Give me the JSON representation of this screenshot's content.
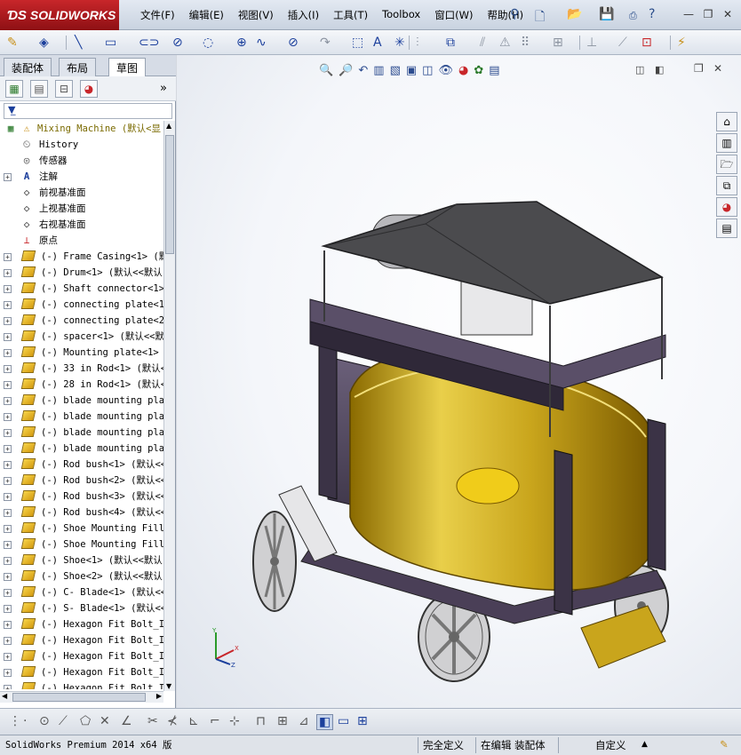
{
  "app": {
    "logo_text": "SOLIDWORKS",
    "menus": [
      "文件(F)",
      "编辑(E)",
      "视图(V)",
      "插入(I)",
      "工具(T)",
      "Toolbox",
      "窗口(W)",
      "帮助(H)"
    ]
  },
  "sidebar": {
    "tabs": [
      "装配体",
      "布局",
      "草图"
    ],
    "active_tab": "草图",
    "tree": [
      {
        "label": "Mixing Machine  (默认<显",
        "kind": "root"
      },
      {
        "label": "History",
        "kind": "history"
      },
      {
        "label": "传感器",
        "kind": "sensor"
      },
      {
        "label": "注解",
        "kind": "annotation"
      },
      {
        "label": "前视基准面",
        "kind": "plane"
      },
      {
        "label": "上视基准面",
        "kind": "plane"
      },
      {
        "label": "右视基准面",
        "kind": "plane"
      },
      {
        "label": "原点",
        "kind": "origin"
      },
      {
        "label": "(-) Frame Casing<1>  (默",
        "kind": "part"
      },
      {
        "label": "(-) Drum<1>  (默认<<默认",
        "kind": "part"
      },
      {
        "label": "(-) Shaft connector<1>",
        "kind": "part"
      },
      {
        "label": "(-) connecting plate<1>",
        "kind": "part"
      },
      {
        "label": "(-) connecting plate<2>",
        "kind": "part"
      },
      {
        "label": "(-) spacer<1>  (默认<<默",
        "kind": "part"
      },
      {
        "label": "(-) Mounting plate<1>  (",
        "kind": "part"
      },
      {
        "label": "(-) 33 in Rod<1>  (默认<",
        "kind": "part"
      },
      {
        "label": "(-) 28 in Rod<1>  (默认<",
        "kind": "part"
      },
      {
        "label": "(-) blade mounting plat",
        "kind": "part"
      },
      {
        "label": "(-) blade mounting plat",
        "kind": "part"
      },
      {
        "label": "(-) blade mounting plat",
        "kind": "part"
      },
      {
        "label": "(-) blade mounting plat",
        "kind": "part"
      },
      {
        "label": "(-) Rod bush<1>  (默认<<",
        "kind": "part"
      },
      {
        "label": "(-) Rod bush<2>  (默认<<",
        "kind": "part"
      },
      {
        "label": "(-) Rod bush<3>  (默认<<",
        "kind": "part"
      },
      {
        "label": "(-) Rod bush<4>  (默认<<",
        "kind": "part"
      },
      {
        "label": "(-) Shoe Mounting Fille",
        "kind": "part"
      },
      {
        "label": "(-) Shoe Mounting Fille",
        "kind": "part"
      },
      {
        "label": "(-) Shoe<1>  (默认<<默认",
        "kind": "part"
      },
      {
        "label": "(-) Shoe<2>  (默认<<默认",
        "kind": "part"
      },
      {
        "label": "(-) C- Blade<1>  (默认<<",
        "kind": "part"
      },
      {
        "label": "(-) S- Blade<1>  (默认<<",
        "kind": "part"
      },
      {
        "label": "(-) Hexagon Fit Bolt_IS",
        "kind": "part"
      },
      {
        "label": "(-) Hexagon Fit Bolt_IS",
        "kind": "part"
      },
      {
        "label": "(-) Hexagon Fit Bolt_IS",
        "kind": "part"
      },
      {
        "label": "(-) Hexagon Fit Bolt_IS",
        "kind": "part"
      },
      {
        "label": "(-) Hexagon Fit Bolt_IS",
        "kind": "part"
      }
    ]
  },
  "statusbar": {
    "product": "SolidWorks Premium 2014 x64 版",
    "definition": "完全定义",
    "editing": "在编辑 装配体",
    "units": "自定义"
  },
  "colors": {
    "drum": "#c9a51c",
    "frame": "#4a3f57",
    "roof": "#4b4b4e",
    "accent": "#c8262a"
  }
}
